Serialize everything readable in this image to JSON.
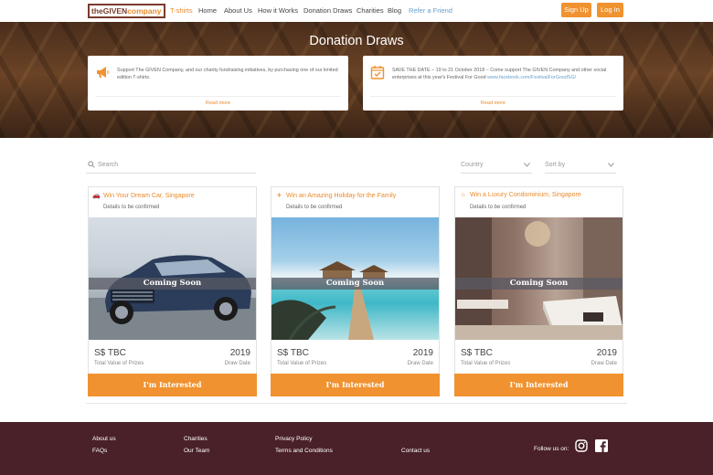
{
  "nav": {
    "logo_a": "the",
    "logo_b": "GIVEN",
    "logo_c": "company",
    "links": [
      "T-shirts",
      "Home",
      "About Us",
      "How it Works",
      "Donation Draws",
      "Charities",
      "Blog",
      "Refer a Friend"
    ],
    "signup": "Sign Up",
    "login": "Log In"
  },
  "hero": {
    "title": "Donation Draws",
    "cards": [
      {
        "icon": "megaphone-icon",
        "text": "Support The GIVEN Company, and our charity fundraising initiatives, by purchasing one of our limited edition T-shirts.",
        "link": "",
        "more": "Read more"
      },
      {
        "icon": "calendar-check-icon",
        "text": "SAVE THE DATE – 19 to 21 October 2018 – Come support The GIVEN Company and other social enterprises at this year's Festival For Good",
        "link": "www.facebook.com/FestivalForGoodSG/",
        "more": "Read more"
      }
    ]
  },
  "filters": {
    "search_placeholder": "Search",
    "country": "Country",
    "sort": "Sort by"
  },
  "draws": [
    {
      "icon": "car-icon",
      "title": "Win Your Dream Car, Singapore",
      "subtitle": "Details to be confirmed",
      "badge": "Coming Soon",
      "price": "S$ TBC",
      "price_label": "Total Value of Prizes",
      "year": "2019",
      "year_label": "Draw Date",
      "button": "I'm Interested"
    },
    {
      "icon": "airplane-icon",
      "title": "Win an Amazing Holiday for the Family",
      "subtitle": "Details to be confirmed",
      "badge": "Coming Soon",
      "price": "S$ TBC",
      "price_label": "Total Value of Prizes",
      "year": "2019",
      "year_label": "Draw Date",
      "button": "I'm Interested"
    },
    {
      "icon": "home-icon",
      "title": "Win a Luxury Condominium, Singapore",
      "subtitle": "Details to be confirmed",
      "badge": "Coming Soon",
      "price": "S$ TBC",
      "price_label": "Total Value of Prizes",
      "year": "2019",
      "year_label": "Draw Date",
      "button": "I'm Interested"
    }
  ],
  "footer": {
    "about": "About us",
    "faqs": "FAQs",
    "charities": "Charities",
    "team": "Our Team",
    "privacy": "Privacy Policy",
    "terms": "Terms and Conditions",
    "contact": "Contact us",
    "follow": "Follow us on:",
    "social": [
      "instagram-icon",
      "facebook-icon"
    ]
  },
  "colors": {
    "accent": "#f0922f",
    "brand": "#7a3b2b",
    "footer": "#4a2128"
  }
}
